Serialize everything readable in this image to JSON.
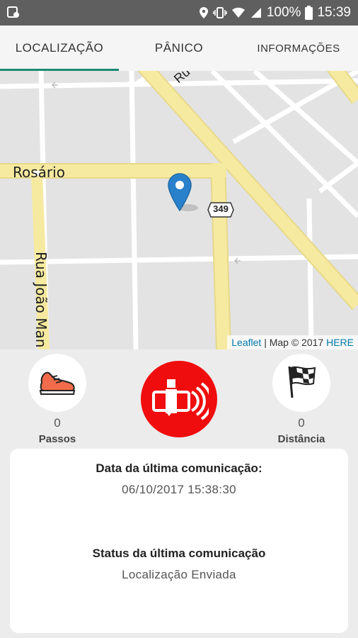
{
  "status_bar": {
    "battery": "100%",
    "time": "15:39"
  },
  "tabs": [
    {
      "label": "LOCALIZAÇÃO",
      "active": true
    },
    {
      "label": "PÂNICO",
      "active": false
    },
    {
      "label": "INFORMAÇÕES",
      "active": false
    }
  ],
  "map": {
    "street_labels": [
      "Rosário",
      "Rua João Man",
      "Ru"
    ],
    "route_shield": "349",
    "attribution": {
      "leaflet": "Leaflet",
      "separator": " | Map © 2017 ",
      "provider": "HERE"
    }
  },
  "controls": {
    "steps": {
      "value": "0",
      "label": "Passos"
    },
    "distance": {
      "value": "0",
      "label": "Distância"
    }
  },
  "info_card": {
    "last_comm_date_title": "Data da última comunicação:",
    "last_comm_date_value": "06/10/2017 15:38:30",
    "last_comm_status_title": "Status da última comunicação",
    "last_comm_status_value": "Localização Enviada"
  },
  "colors": {
    "accent": "#1d8b73",
    "panic": "#f00d0d",
    "road_major": "#f6eaa0",
    "map_bg": "#e3e3e3",
    "marker": "#2a81cb"
  }
}
